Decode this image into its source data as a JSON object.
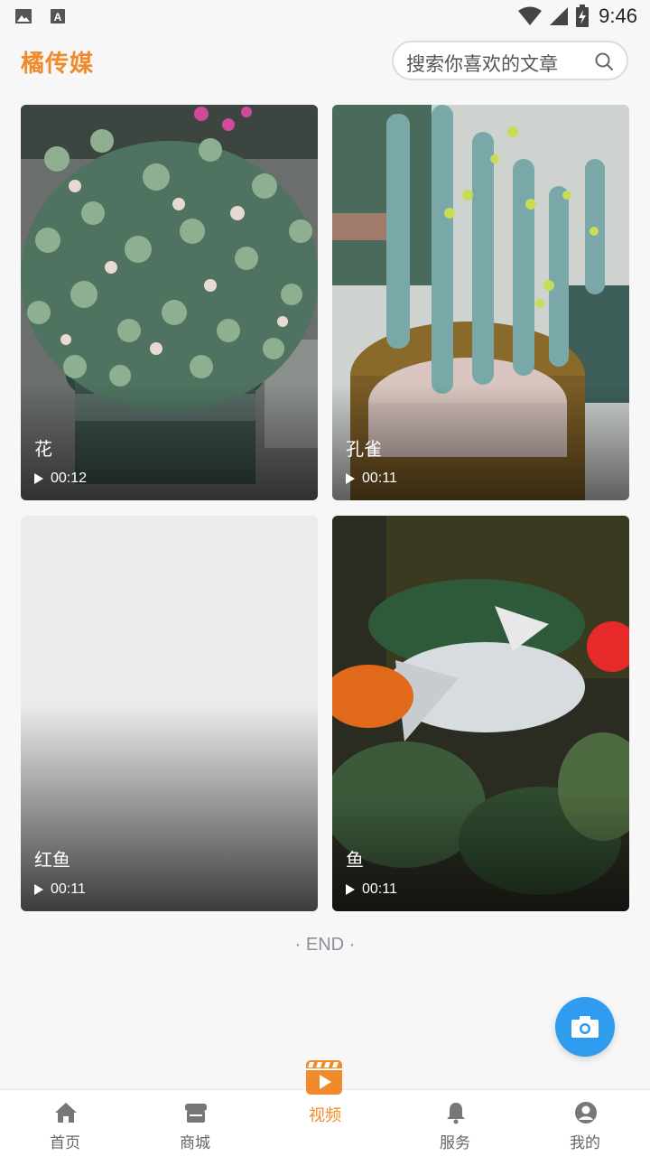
{
  "status_bar": {
    "time": "9:46",
    "icons": [
      "image-icon",
      "text-a-icon",
      "wifi-icon",
      "signal-icon",
      "battery-charging-icon"
    ]
  },
  "header": {
    "brand": "橘传媒",
    "search_placeholder": "搜索你喜欢的文章"
  },
  "videos": [
    {
      "title": "花",
      "duration": "00:12",
      "scene": "succulent plant"
    },
    {
      "title": "孔雀",
      "duration": "00:11",
      "scene": "cactus in pot"
    },
    {
      "title": "红鱼",
      "duration": "00:11",
      "scene": "blank"
    },
    {
      "title": "鱼",
      "duration": "00:11",
      "scene": "goldfish"
    }
  ],
  "end_label": "· END ·",
  "colors": {
    "accent": "#f08a2a",
    "fab": "#2f9cf0"
  },
  "tabbar": {
    "items": [
      {
        "label": "首页",
        "icon": "home-icon"
      },
      {
        "label": "商城",
        "icon": "store-icon"
      },
      {
        "label": "视频",
        "icon": "video-play-icon",
        "active": true
      },
      {
        "label": "服务",
        "icon": "bell-icon"
      },
      {
        "label": "我的",
        "icon": "profile-icon"
      }
    ]
  }
}
